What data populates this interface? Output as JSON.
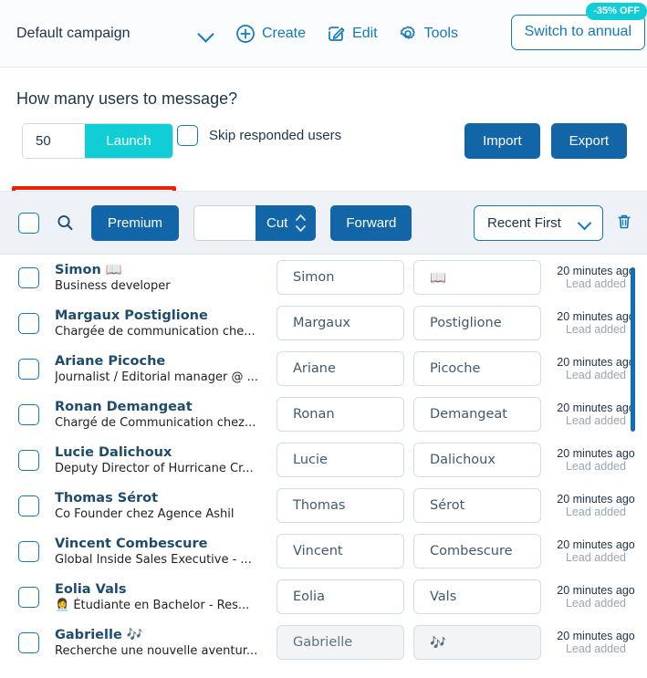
{
  "topbar": {
    "campaign": "Default campaign",
    "campaign_chevron": "chevron-down-icon",
    "actions": [
      {
        "label": "Create",
        "icon": "plus-circle-icon"
      },
      {
        "label": "Edit",
        "icon": "pencil-square-icon"
      },
      {
        "label": "Tools",
        "icon": "gear-icon"
      }
    ],
    "switch_label": "Switch to annual",
    "off_badge": "-35% OFF",
    "accent": "#1179bf",
    "badge_color": "#11ced6"
  },
  "message_section": {
    "title": "How many users to message?",
    "count_value": "50",
    "launch_label": "Launch",
    "launch_color": "#11ced6",
    "skip_label": "Skip responded users",
    "skip_checked": false,
    "import_label": "Import",
    "export_label": "Export",
    "highlight_color": "#ef2000"
  },
  "toolbar": {
    "select_all_checked": false,
    "search_icon": "search-icon",
    "premium_label": "Premium",
    "cut_value": "",
    "cut_label": "Cut",
    "cut_spinner": "spinner-up-down-icon",
    "forward_label": "Forward",
    "sort_label": "Recent First",
    "sort_chevron": "chevron-down-icon",
    "delete_icon": "trash-icon",
    "button_color": "#1266a8"
  },
  "list": {
    "time_sub_label": "Lead added",
    "time_ago_label": "20 minutes ago",
    "rows": [
      {
        "name": "Simon 📖",
        "title": "Business developer",
        "first": "Simon",
        "last": "📖",
        "ago": "20 minutes ago",
        "sub": "Lead added"
      },
      {
        "name": "Margaux Postiglione",
        "title": "Chargée de communication che...",
        "first": "Margaux",
        "last": "Postiglione",
        "ago": "20 minutes ago",
        "sub": "Lead added"
      },
      {
        "name": "Ariane Picoche",
        "title": "Journalist / Editorial manager @ ...",
        "first": "Ariane",
        "last": "Picoche",
        "ago": "20 minutes ago",
        "sub": "Lead added"
      },
      {
        "name": "Ronan Demangeat",
        "title": "Chargé de Communication chez...",
        "first": "Ronan",
        "last": "Demangeat",
        "ago": "20 minutes ago",
        "sub": "Lead added"
      },
      {
        "name": "Lucie Dalichoux",
        "title": "Deputy Director of Hurricane Cr...",
        "first": "Lucie",
        "last": "Dalichoux",
        "ago": "20 minutes ago",
        "sub": "Lead added"
      },
      {
        "name": "Thomas Sérot",
        "title": "Co Founder chez Agence Ashil",
        "first": "Thomas",
        "last": "Sérot",
        "ago": "20 minutes ago",
        "sub": "Lead added"
      },
      {
        "name": "Vincent Combescure",
        "title": "Global Inside Sales Executive - ...",
        "first": "Vincent",
        "last": "Combescure",
        "ago": "20 minutes ago",
        "sub": "Lead added"
      },
      {
        "name": "Eolia Vals",
        "title": "👩‍💼 Étudiante en Bachelor - Res...",
        "first": "Eolia",
        "last": "Vals",
        "ago": "20 minutes ago",
        "sub": "Lead added"
      },
      {
        "name": "Gabrielle 🎶",
        "title": "Recherche une nouvelle aventur...",
        "first": "Gabrielle",
        "last": "🎶",
        "ago": "20 minutes ago",
        "sub": "Lead added"
      }
    ]
  }
}
